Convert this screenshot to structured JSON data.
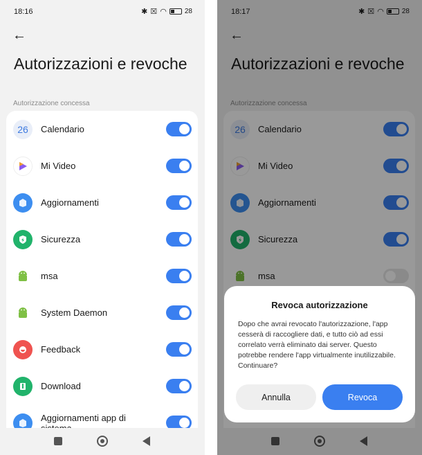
{
  "screens": [
    {
      "time": "18:16",
      "battery": "28",
      "title": "Autorizzazioni e revoche",
      "section": "Autorizzazione concessa",
      "apps": [
        {
          "label": "Calendario",
          "icon": "calendar-icon",
          "icon_text": "26",
          "on": true
        },
        {
          "label": "Mi Video",
          "icon": "mi-video-icon",
          "on": true
        },
        {
          "label": "Aggiornamenti",
          "icon": "updater-icon",
          "on": true
        },
        {
          "label": "Sicurezza",
          "icon": "security-icon",
          "on": true
        },
        {
          "label": "msa",
          "icon": "android-icon",
          "on": true
        },
        {
          "label": "System Daemon",
          "icon": "android-icon",
          "on": true
        },
        {
          "label": "Feedback",
          "icon": "feedback-icon",
          "on": true
        },
        {
          "label": "Download",
          "icon": "download-icon",
          "on": true
        },
        {
          "label": "Aggiornamenti app di sistema",
          "icon": "updater-icon",
          "on": true
        }
      ]
    },
    {
      "time": "18:17",
      "battery": "28",
      "title": "Autorizzazioni e revoche",
      "section": "Autorizzazione concessa",
      "apps": [
        {
          "label": "Calendario",
          "icon": "calendar-icon",
          "icon_text": "26",
          "on": true
        },
        {
          "label": "Mi Video",
          "icon": "mi-video-icon",
          "on": true
        },
        {
          "label": "Aggiornamenti",
          "icon": "updater-icon",
          "on": true
        },
        {
          "label": "Sicurezza",
          "icon": "security-icon",
          "on": true
        },
        {
          "label": "msa",
          "icon": "android-icon",
          "on": false
        }
      ],
      "dialog": {
        "title": "Revoca autorizzazione",
        "body": "Dopo che avrai revocato l'autorizzazione, l'app cesserà di raccogliere dati, e tutto ciò ad essi correlato verrà eliminato dai server. Questo potrebbe rendere l'app virtualmente inutilizzabile. Continuare?",
        "cancel_label": "Annulla",
        "confirm_label": "Revoca"
      }
    }
  ],
  "colors": {
    "accent": "#3a7ff0",
    "calendar": "#e9eef8",
    "updater": "#3d8ef0",
    "security": "#21b36b",
    "android": "#7fc045",
    "feedback": "#ef5350",
    "download": "#21b36b"
  }
}
